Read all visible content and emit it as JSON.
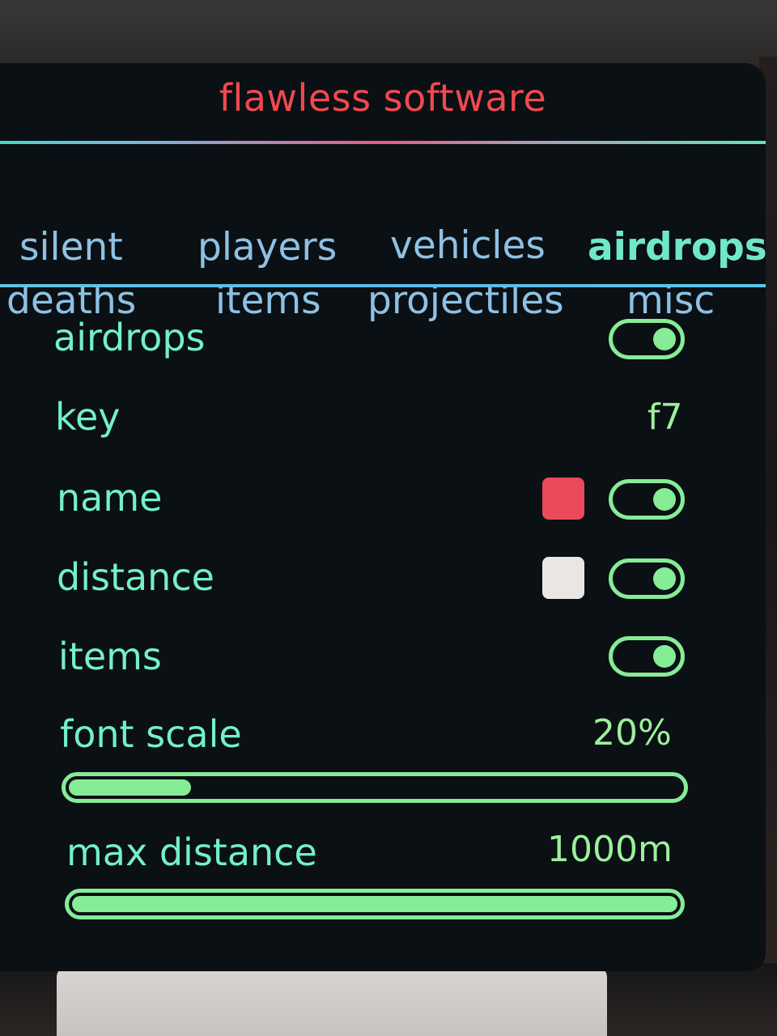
{
  "title": "flawless software",
  "tabs": [
    {
      "label": "silent",
      "active": false
    },
    {
      "label": "players",
      "active": false
    },
    {
      "label": "vehicles",
      "active": false
    },
    {
      "label": "airdrops",
      "active": true
    },
    {
      "label": "deaths",
      "active": false
    },
    {
      "label": "items",
      "active": false
    },
    {
      "label": "projectiles",
      "active": false
    },
    {
      "label": "misc",
      "active": false
    }
  ],
  "settings": {
    "airdrops": {
      "label": "airdrops",
      "enabled": true
    },
    "key": {
      "label": "key",
      "value": "f7"
    },
    "name": {
      "label": "name",
      "enabled": true,
      "color": "#ea4a5a"
    },
    "distance": {
      "label": "distance",
      "enabled": true,
      "color": "#e9e6e4"
    },
    "items": {
      "label": "items",
      "enabled": true
    },
    "font_scale": {
      "label": "font scale",
      "value": "20%",
      "fraction": 0.2
    },
    "max_distance": {
      "label": "max distance",
      "value": "1000m",
      "fraction": 1.0
    }
  },
  "colors": {
    "title": "#f0494f",
    "tab": "#8ec1e4",
    "tab_active": "#70e7c9",
    "label": "#74f0c4",
    "accent": "#86ec96",
    "panel": "#0a1014"
  }
}
